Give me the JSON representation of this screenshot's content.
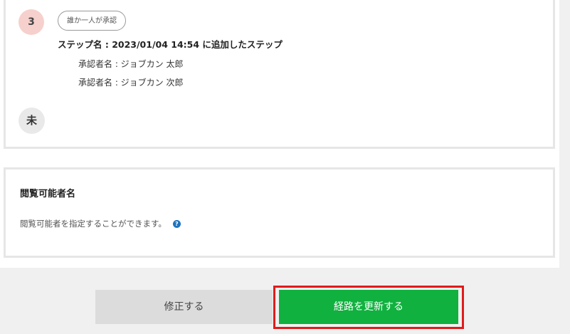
{
  "route": {
    "step_number": "3",
    "approval_type": "誰か一人が承認",
    "step_name": "ステップ名 : 2023/01/04 14:54 に追加したステップ",
    "approvers": [
      "承認者名 : ジョブカン 太郎",
      "承認者名 : ジョブカン 次郎"
    ],
    "end_label": "未"
  },
  "viewers": {
    "title": "閲覧可能者名",
    "description": "閲覧可能者を指定することができます。",
    "help_glyph": "?"
  },
  "actions": {
    "modify_label": "修正する",
    "update_label": "経路を更新する"
  },
  "colors": {
    "update_button": "#10b13f",
    "highlight": "#e01b1b",
    "step_badge": "#f6d0cc",
    "help_icon": "#1e73be"
  }
}
